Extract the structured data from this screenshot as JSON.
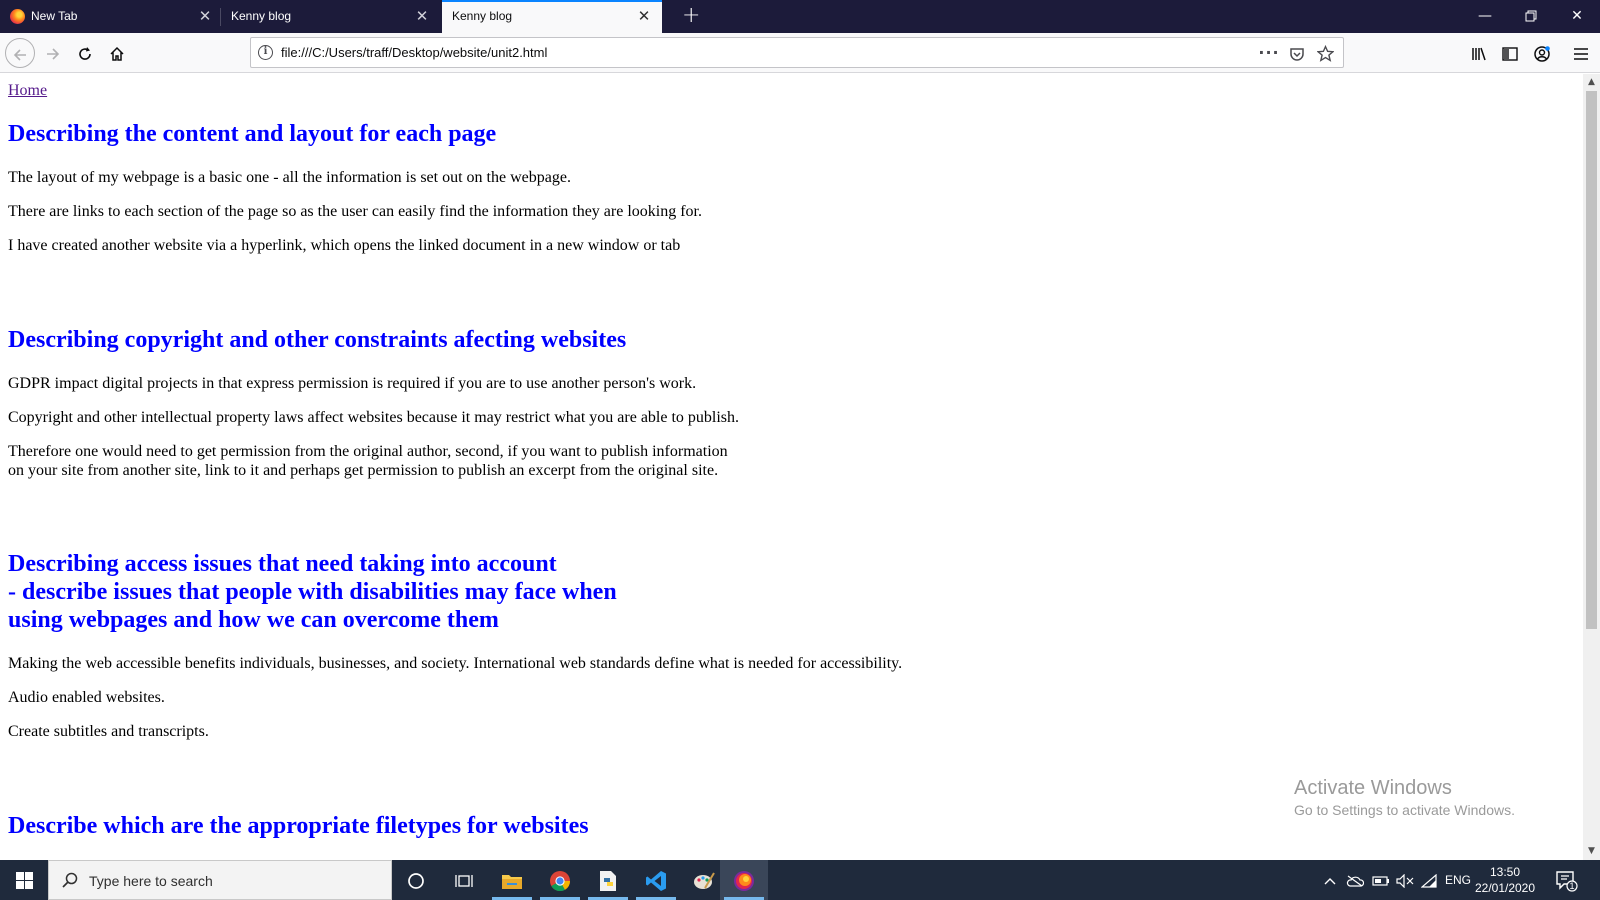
{
  "browser": {
    "tabs": [
      {
        "title": "New Tab",
        "active": false
      },
      {
        "title": "Kenny blog",
        "active": false
      },
      {
        "title": "Kenny blog",
        "active": true
      }
    ],
    "url": "file:///C:/Users/traff/Desktop/website/unit2.html",
    "accent_color": "#0a84ff"
  },
  "page": {
    "home_link": "Home",
    "sections": [
      {
        "heading": "Describing the content and layout for each page",
        "paragraphs": [
          "The layout of my webpage is a basic one - all the information is set out on the webpage.",
          "There are links to each section of the page so as the user can easily find the information they are looking for.",
          "I have created another website via a hyperlink, which opens the linked document in a new window or tab"
        ]
      },
      {
        "heading": "Describing copyright and other constraints afecting websites",
        "paragraphs": [
          "GDPR impact digital projects in that express permission is required if you are to use another person's work.",
          "Copyright and other intellectual property laws affect websites because it may restrict what you are able to publish.",
          "Therefore one would need to get permission from the original author, second, if you want to publish information\non your site from another site, link to it and perhaps get permission to publish an excerpt from the original site."
        ]
      },
      {
        "heading": "Describing access issues that need taking into account\n- describe issues that people with disabilities may face when\nusing webpages and how we can overcome them",
        "paragraphs": [
          "Making the web accessible benefits individuals, businesses, and society. International web standards define what is needed for accessibility.",
          "Audio enabled websites.",
          "Create subtitles and transcripts."
        ]
      },
      {
        "heading": "Describe which are the appropriate filetypes for websites",
        "paragraphs": []
      }
    ],
    "heading_color": "#0000ff",
    "link_color": "#551a8b"
  },
  "watermark": {
    "line1": "Activate Windows",
    "line2": "Go to Settings to activate Windows."
  },
  "taskbar": {
    "search_placeholder": "Type here to search",
    "apps": [
      "cortana-icon",
      "task-view-icon",
      "file-explorer-icon",
      "chrome-icon",
      "python-idle-icon",
      "vscode-icon",
      "paint-icon",
      "firefox-icon"
    ],
    "language": "ENG",
    "time": "13:50",
    "date": "22/01/2020",
    "notification_count": "1"
  }
}
